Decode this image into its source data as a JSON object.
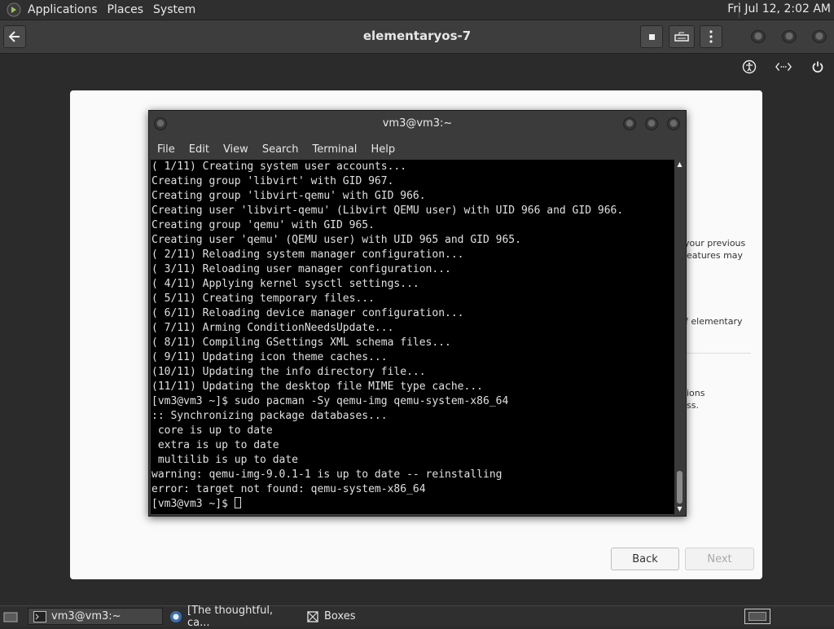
{
  "top_panel": {
    "menus": [
      "Applications",
      "Places",
      "System"
    ],
    "clock": "Fri Jul 12,  2:02 AM"
  },
  "headerbar": {
    "title": "elementaryos-7",
    "back_icon": "back-arrow-icon",
    "stop_icon": "stop-icon",
    "keyboard_icon": "keyboard-icon",
    "menu_icon": "kebab-menu-icon"
  },
  "vm_top_icons": [
    "accessibility-icon",
    "network-icon",
    "power-icon"
  ],
  "installer": {
    "text_fragments": [
      "your previous",
      "eatures may",
      "f elementary",
      "ions",
      "ss."
    ],
    "back_label": "Back",
    "next_label": "Next"
  },
  "terminal": {
    "title": "vm3@vm3:~",
    "menu": [
      "File",
      "Edit",
      "View",
      "Search",
      "Terminal",
      "Help"
    ],
    "lines": [
      "( 1/11) Creating system user accounts...",
      "Creating group 'libvirt' with GID 967.",
      "Creating group 'libvirt-qemu' with GID 966.",
      "Creating user 'libvirt-qemu' (Libvirt QEMU user) with UID 966 and GID 966.",
      "Creating group 'qemu' with GID 965.",
      "Creating user 'qemu' (QEMU user) with UID 965 and GID 965.",
      "( 2/11) Reloading system manager configuration...",
      "( 3/11) Reloading user manager configuration...",
      "( 4/11) Applying kernel sysctl settings...",
      "( 5/11) Creating temporary files...",
      "( 6/11) Reloading device manager configuration...",
      "( 7/11) Arming ConditionNeedsUpdate...",
      "( 8/11) Compiling GSettings XML schema files...",
      "( 9/11) Updating icon theme caches...",
      "(10/11) Updating the info directory file...",
      "(11/11) Updating the desktop file MIME type cache...",
      "[vm3@vm3 ~]$ sudo pacman -Sy qemu-img qemu-system-x86_64",
      ":: Synchronizing package databases...",
      " core is up to date",
      " extra is up to date",
      " multilib is up to date",
      "warning: qemu-img-9.0.1-1 is up to date -- reinstalling",
      "error: target not found: qemu-system-x86_64",
      "[vm3@vm3 ~]$ "
    ]
  },
  "taskbar": {
    "tasks": [
      {
        "label": "vm3@vm3:~",
        "icon": "terminal-icon"
      },
      {
        "label": "[The thoughtful, ca...",
        "icon": "browser-icon"
      },
      {
        "label": "Boxes",
        "icon": "boxes-icon"
      }
    ]
  }
}
